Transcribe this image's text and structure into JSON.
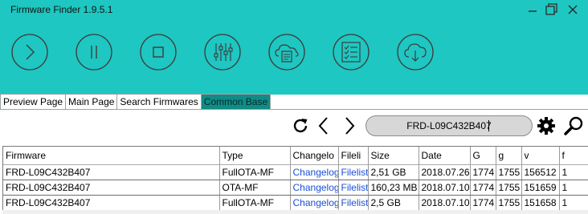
{
  "window": {
    "title": "Firmware Finder 1.9.5.1",
    "accent_color": "#1ec7c1",
    "active_tab_color": "#108b86",
    "controls": [
      "minimize-icon",
      "restore-icon",
      "close-icon"
    ]
  },
  "toolbar": {
    "buttons": [
      {
        "name": "play-icon"
      },
      {
        "name": "pause-icon"
      },
      {
        "name": "stop-icon"
      },
      {
        "name": "sliders-icon"
      },
      {
        "name": "cloud-document-icon"
      },
      {
        "name": "checklist-icon"
      },
      {
        "name": "cloud-download-icon"
      }
    ]
  },
  "tabs": [
    {
      "label": "Preview Page",
      "active": false
    },
    {
      "label": "Main Page",
      "active": false
    },
    {
      "label": "Search Firmwares",
      "active": false
    },
    {
      "label": "Common Base",
      "active": true
    }
  ],
  "search": {
    "value": "FRD-L09C432B407",
    "icons": [
      "refresh-icon",
      "chevron-left-icon",
      "chevron-right-icon",
      "gear-icon",
      "search-icon"
    ]
  },
  "table": {
    "columns": [
      "Firmware",
      "Type",
      "Changelo",
      "Fileli",
      "Size",
      "Date",
      "G",
      "g",
      "v",
      "f"
    ],
    "rows": [
      [
        "FRD-L09C432B407",
        "FullOTA-MF",
        "Changelog",
        "Filelist",
        "2,51 GB",
        "2018.07.26",
        "1774",
        "1755",
        "156512",
        "1"
      ],
      [
        "FRD-L09C432B407",
        "OTA-MF",
        "Changelog",
        "Filelist",
        "160,23 MB",
        "2018.07.10",
        "1774",
        "1755",
        "151659",
        "1"
      ],
      [
        "FRD-L09C432B407",
        "FullOTA-MF",
        "Changelog",
        "Filelist",
        "2,5 GB",
        "2018.07.10",
        "1774",
        "1755",
        "151658",
        "1"
      ]
    ]
  }
}
